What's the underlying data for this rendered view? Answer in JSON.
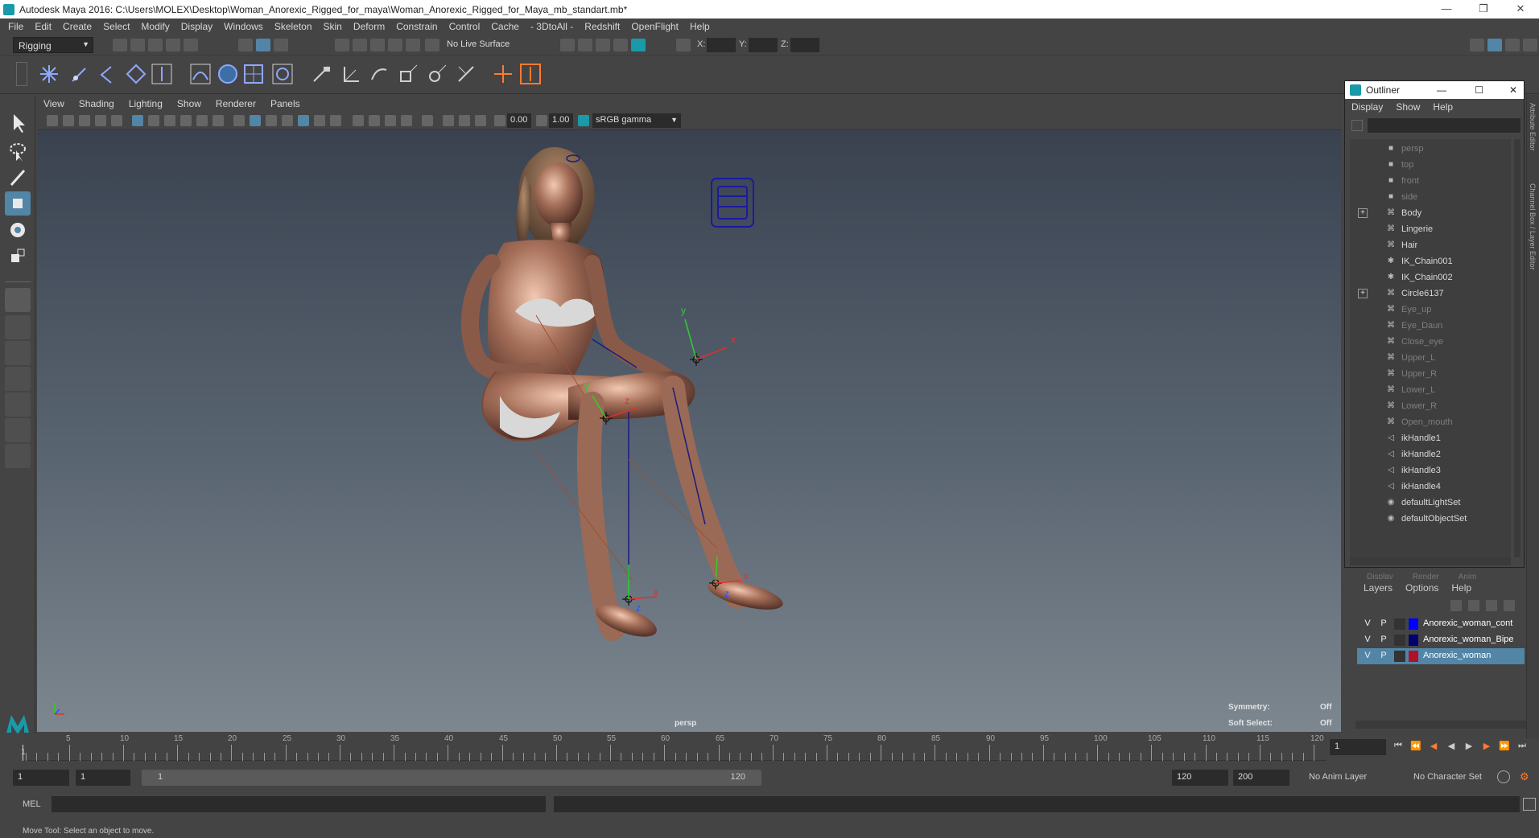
{
  "window": {
    "title": "Autodesk Maya 2016: C:\\Users\\MOLEX\\Desktop\\Woman_Anorexic_Rigged_for_maya\\Woman_Anorexic_Rigged_for_Maya_mb_standart.mb*",
    "minimize": "—",
    "restore": "❐",
    "close": "✕"
  },
  "menus": [
    "File",
    "Edit",
    "Create",
    "Select",
    "Modify",
    "Display",
    "Windows",
    "Skeleton",
    "Skin",
    "Deform",
    "Constrain",
    "Control",
    "Cache",
    "- 3DtoAll -",
    "Redshift",
    "OpenFlight",
    "Help"
  ],
  "status_line": {
    "mode": "Rigging",
    "live_surface": "No Live Surface",
    "x_label": "X:",
    "y_label": "Y:",
    "z_label": "Z:"
  },
  "panel_menus": [
    "View",
    "Shading",
    "Lighting",
    "Show",
    "Renderer",
    "Panels"
  ],
  "panel_toolbar": {
    "exposure": "0.00",
    "gamma": "1.00",
    "color_space": "sRGB gamma"
  },
  "viewport": {
    "camera": "persp",
    "symmetry_label": "Symmetry:",
    "symmetry_value": "Off",
    "soft_select_label": "Soft Select:",
    "soft_select_value": "Off",
    "axis_labels": [
      "y",
      "z",
      "x"
    ]
  },
  "timeline": {
    "ticks": [
      "5",
      "10",
      "15",
      "20",
      "25",
      "30",
      "35",
      "40",
      "45",
      "50",
      "55",
      "60",
      "65",
      "70",
      "75",
      "80",
      "85",
      "90",
      "95",
      "100",
      "105",
      "110",
      "115",
      "120"
    ],
    "start_marker": "1",
    "current_frame": "1"
  },
  "range": {
    "start": "1",
    "anim_start": "1",
    "range_start": "1",
    "range_end": "120",
    "anim_end": "120",
    "end": "200",
    "anim_layer": "No Anim Layer",
    "character_set": "No Character Set"
  },
  "command_line": {
    "label": "MEL"
  },
  "help_line": "Move Tool: Select an object to move.",
  "outliner": {
    "title": "Outliner",
    "menus": [
      "Display",
      "Show",
      "Help"
    ],
    "items": [
      {
        "label": "persp",
        "icon": "camera-icon",
        "dim": true,
        "expand": ""
      },
      {
        "label": "top",
        "icon": "camera-icon",
        "dim": true,
        "expand": ""
      },
      {
        "label": "front",
        "icon": "camera-icon",
        "dim": true,
        "expand": ""
      },
      {
        "label": "side",
        "icon": "camera-icon",
        "dim": true,
        "expand": ""
      },
      {
        "label": "Body",
        "icon": "transform-icon",
        "dim": false,
        "expand": "+"
      },
      {
        "label": "Lingerie",
        "icon": "transform-icon",
        "dim": false,
        "expand": ""
      },
      {
        "label": "Hair",
        "icon": "transform-icon",
        "dim": false,
        "expand": ""
      },
      {
        "label": "IK_Chain001",
        "icon": "joint-icon",
        "dim": false,
        "expand": ""
      },
      {
        "label": "IK_Chain002",
        "icon": "joint-icon",
        "dim": false,
        "expand": ""
      },
      {
        "label": "Circle6137",
        "icon": "transform-icon",
        "dim": false,
        "expand": "+"
      },
      {
        "label": "Eye_up",
        "icon": "transform-icon",
        "dim": true,
        "expand": ""
      },
      {
        "label": "Eye_Daun",
        "icon": "transform-icon",
        "dim": true,
        "expand": ""
      },
      {
        "label": "Close_eye",
        "icon": "transform-icon",
        "dim": true,
        "expand": ""
      },
      {
        "label": "Upper_L",
        "icon": "transform-icon",
        "dim": true,
        "expand": ""
      },
      {
        "label": "Upper_R",
        "icon": "transform-icon",
        "dim": true,
        "expand": ""
      },
      {
        "label": "Lower_L",
        "icon": "transform-icon",
        "dim": true,
        "expand": ""
      },
      {
        "label": "Lower_R",
        "icon": "transform-icon",
        "dim": true,
        "expand": ""
      },
      {
        "label": "Open_mouth",
        "icon": "transform-icon",
        "dim": true,
        "expand": ""
      },
      {
        "label": "ikHandle1",
        "icon": "ik-handle-icon",
        "dim": false,
        "expand": ""
      },
      {
        "label": "ikHandle2",
        "icon": "ik-handle-icon",
        "dim": false,
        "expand": ""
      },
      {
        "label": "ikHandle3",
        "icon": "ik-handle-icon",
        "dim": false,
        "expand": ""
      },
      {
        "label": "ikHandle4",
        "icon": "ik-handle-icon",
        "dim": false,
        "expand": ""
      },
      {
        "label": "defaultLightSet",
        "icon": "set-icon",
        "dim": false,
        "expand": ""
      },
      {
        "label": "defaultObjectSet",
        "icon": "set-icon",
        "dim": false,
        "expand": ""
      }
    ]
  },
  "layer_editor": {
    "tabs": [
      "Display",
      "Render",
      "Anim"
    ],
    "menus": [
      "Layers",
      "Options",
      "Help"
    ],
    "layers": [
      {
        "v": "V",
        "p": "P",
        "color": "#0000ff",
        "name": "Anorexic_woman_cont",
        "selected": false
      },
      {
        "v": "V",
        "p": "P",
        "color": "#00006e",
        "name": "Anorexic_woman_Bipe",
        "selected": false
      },
      {
        "v": "V",
        "p": "P",
        "color": "#b0102a",
        "name": "Anorexic_woman",
        "selected": true
      }
    ]
  },
  "side_tabs": [
    "Attribute Editor",
    "Channel Box / Layer Editor"
  ],
  "colors": {
    "ui_bg": "#444444",
    "field_bg": "#2b2b2b",
    "selected_row": "#5285a6",
    "accent_teal": "#1a9aa8"
  }
}
